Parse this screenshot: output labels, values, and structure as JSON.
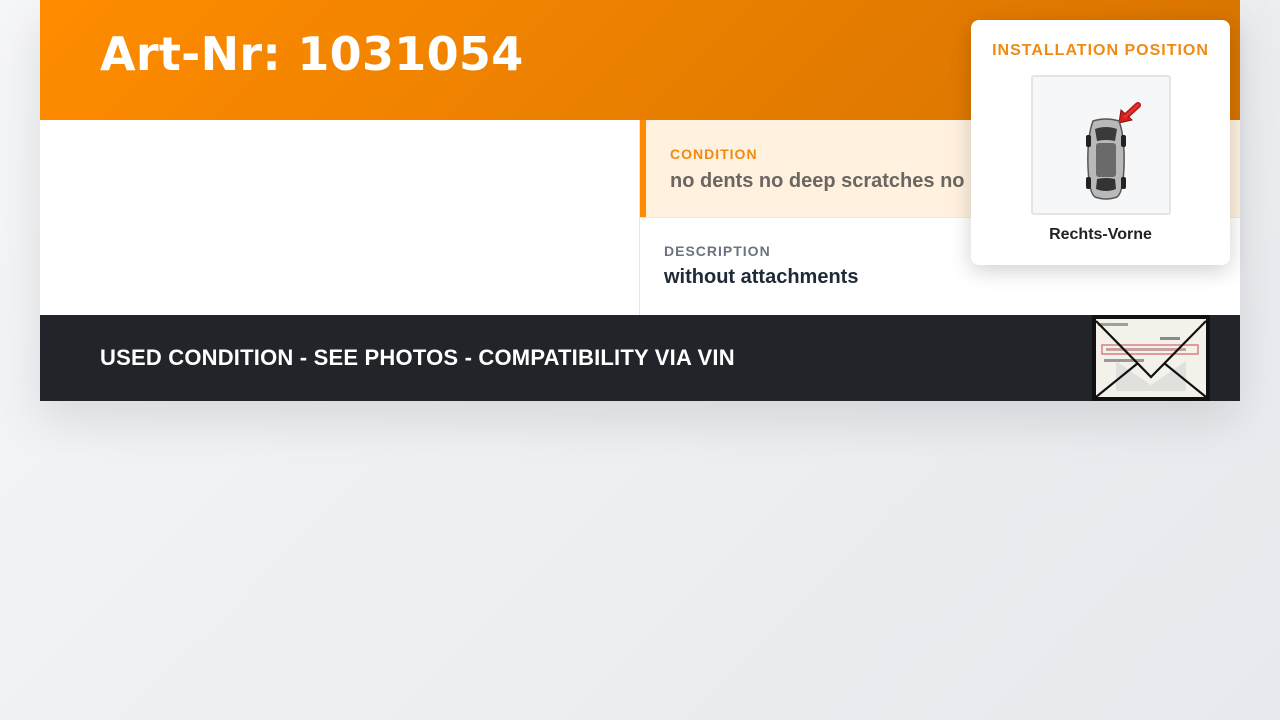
{
  "header": {
    "title": "Art-Nr: 1031054",
    "accent_color": "#ff8c00"
  },
  "condition": {
    "label": "CONDITION",
    "value": "no dents no deep scratches no"
  },
  "description": {
    "label": "DESCRIPTION",
    "value": "without attachments"
  },
  "footer": {
    "text": "USED CONDITION - SEE PHOTOS - COMPATIBILITY VIA VIN",
    "thumbnail_icon": "mail-envelope-icon"
  },
  "installation_popover": {
    "heading": "INSTALLATION POSITION",
    "position_label": "Rechts-Vorne",
    "image_icon": "car-top-view-icon",
    "marker_icon": "red-arrow-icon"
  }
}
